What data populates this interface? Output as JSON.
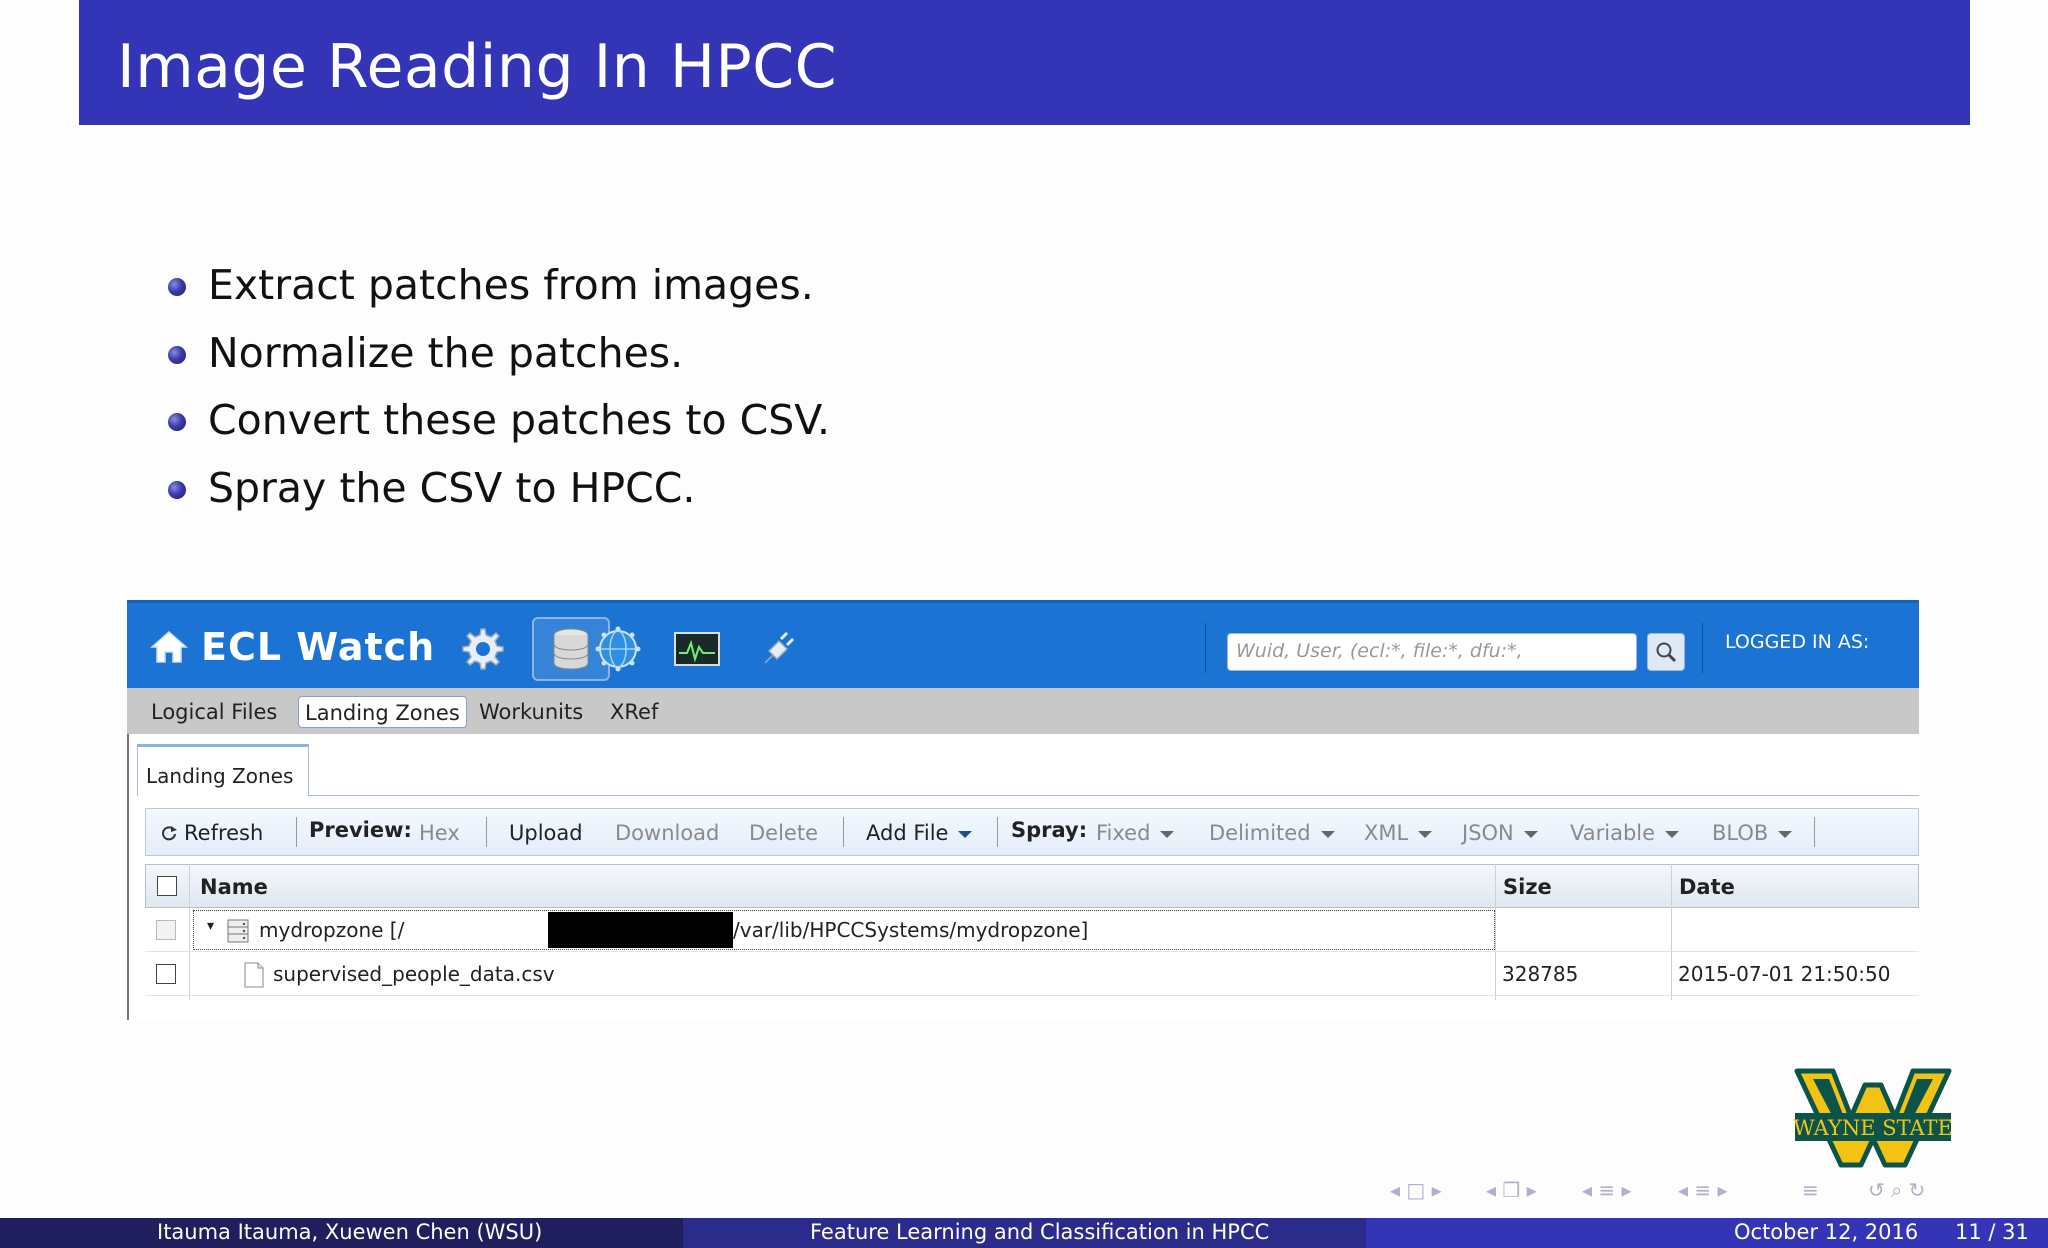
{
  "slide": {
    "title": "Image Reading In HPCC",
    "bullets": [
      "Extract patches from images.",
      "Normalize the patches.",
      "Convert these patches to CSV.",
      "Spray the CSV to HPCC."
    ]
  },
  "ecl_watch": {
    "app_title": "ECL Watch",
    "search_placeholder": "Wuid, User, (ecl:*, file:*, dfu:*,",
    "logged_in_label": "LOGGED IN AS:",
    "tabs": [
      "Logical Files",
      "Landing Zones",
      "Workunits",
      "XRef"
    ],
    "active_tab": "Landing Zones",
    "panel_tab": "Landing Zones",
    "toolbar": {
      "refresh": "Refresh",
      "preview_label": "Preview:",
      "hex": "Hex",
      "upload": "Upload",
      "download": "Download",
      "delete": "Delete",
      "add_file": "Add File",
      "spray_label": "Spray:",
      "fixed": "Fixed",
      "delimited": "Delimited",
      "xml": "XML",
      "json": "JSON",
      "variable": "Variable",
      "blob": "BLOB"
    },
    "grid": {
      "columns": [
        "Name",
        "Size",
        "Date"
      ],
      "rows": [
        {
          "name_prefix": "mydropzone [/",
          "name_suffix": "/var/lib/HPCCSystems/mydropzone]",
          "size": "",
          "date": ""
        },
        {
          "name": "supervised_people_data.csv",
          "size": "328785",
          "date": "2015-07-01 21:50:50"
        }
      ]
    }
  },
  "logo_text": "WAYNE STATE",
  "footer": {
    "authors": "Itauma Itauma, Xuewen Chen  (WSU)",
    "talk_title": "Feature Learning and Classification in HPCC",
    "date": "October 12, 2016",
    "page": "11 / 31"
  },
  "colors": {
    "title_bar": "#3434b6",
    "ecl_header": "#1b73d3",
    "footer_dark": "#1f1f5e",
    "footer_mid": "#2b2b8c",
    "logo_green": "#0c5449",
    "logo_gold": "#f2c312"
  }
}
